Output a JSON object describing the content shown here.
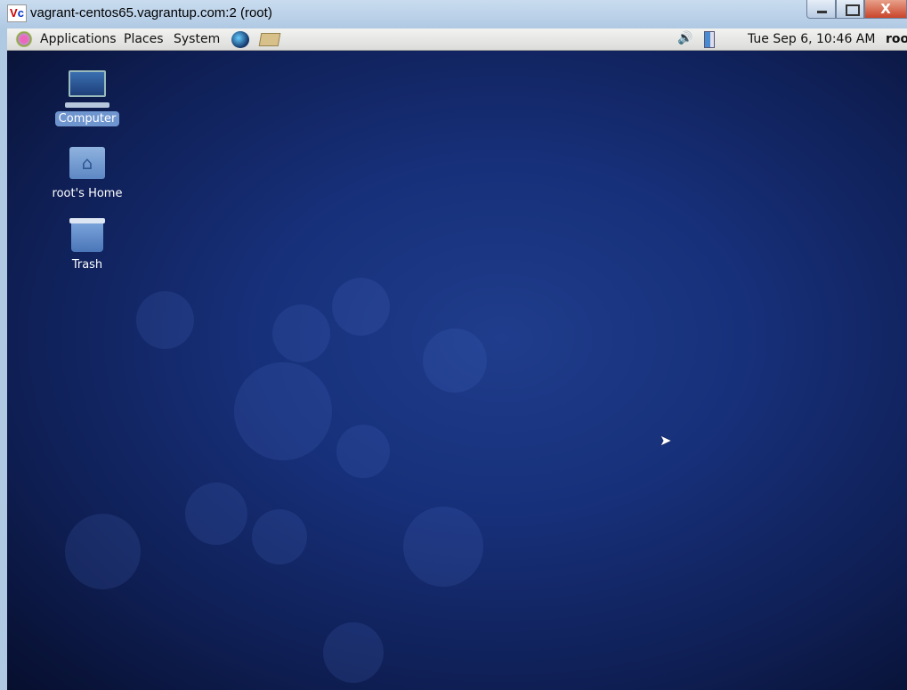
{
  "window": {
    "title": "vagrant-centos65.vagrantup.com:2 (root)",
    "logo": "VNC",
    "close_label": "X"
  },
  "panel": {
    "menus": [
      "Applications",
      "Places",
      "System"
    ],
    "clock": "Tue Sep  6, 10:46 AM",
    "user": "root"
  },
  "desktop": {
    "icons": [
      {
        "label": "Computer",
        "selected": true
      },
      {
        "label": "root's Home"
      },
      {
        "label": "Trash"
      }
    ]
  }
}
